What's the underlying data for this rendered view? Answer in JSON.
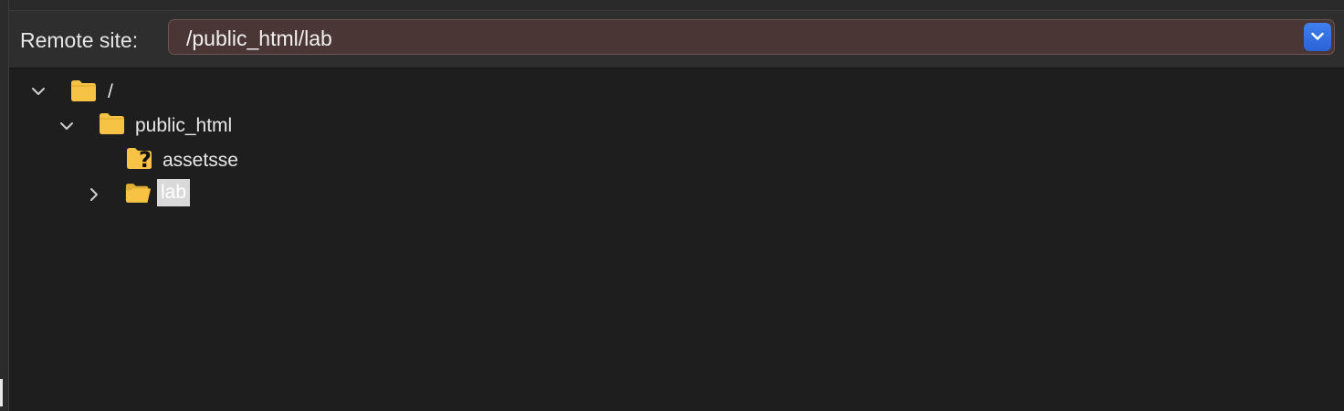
{
  "header": {
    "label": "Remote site:",
    "path_value": "/public_html/lab",
    "dropdown_icon": "chevron-down-icon",
    "accent_color": "#2f6fe6"
  },
  "tree": {
    "nodes": [
      {
        "label": "/",
        "expanded": true,
        "icon": "folder-icon",
        "level": 0
      },
      {
        "label": "public_html",
        "expanded": true,
        "icon": "folder-icon",
        "level": 1
      },
      {
        "label": "assetsse",
        "icon": "folder-unknown-icon",
        "level": 2
      },
      {
        "label": "lab",
        "expanded": false,
        "selected": true,
        "icon": "folder-open-icon",
        "level": 2
      }
    ],
    "folder_color": "#f6c344"
  }
}
